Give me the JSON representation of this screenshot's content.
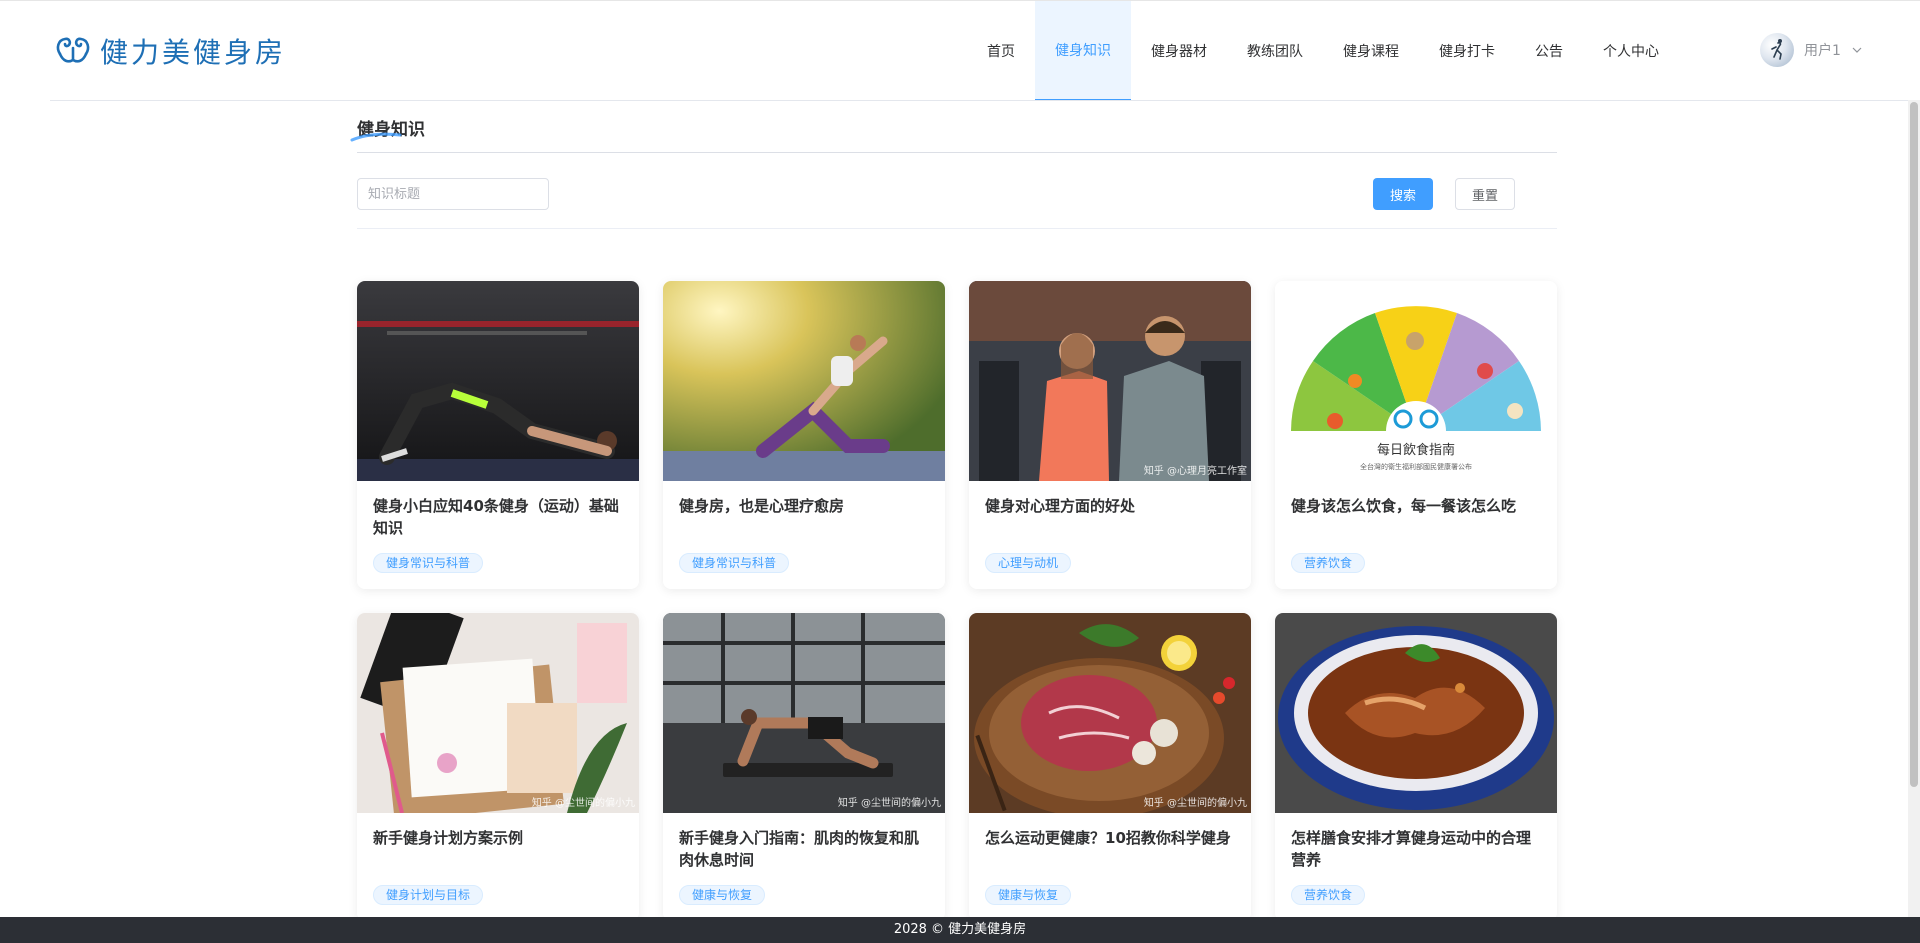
{
  "brand": {
    "name": "健力美健身房",
    "icon": "bicep-icon",
    "color": "#1e6fb5"
  },
  "nav": {
    "items": [
      {
        "label": "首页"
      },
      {
        "label": "健身知识",
        "active": true
      },
      {
        "label": "健身器材"
      },
      {
        "label": "教练团队"
      },
      {
        "label": "健身课程"
      },
      {
        "label": "健身打卡"
      },
      {
        "label": "公告"
      },
      {
        "label": "个人中心"
      }
    ],
    "accent": "#409eff"
  },
  "user": {
    "name": "用户1",
    "icon": "chevron-down-icon"
  },
  "page": {
    "title": "健身知识"
  },
  "search": {
    "placeholder": "知识标题",
    "value": "",
    "search_label": "搜索",
    "reset_label": "重置"
  },
  "cards": [
    {
      "title": "健身小白应知40条健身（运动）基础知识",
      "tag": "健身常识与科普",
      "image": "glute-bridge-photo",
      "watermark": ""
    },
    {
      "title": "健身房，也是心理疗愈房",
      "tag": "健身常识与科普",
      "image": "outdoor-yoga-photo",
      "watermark": ""
    },
    {
      "title": "健身对心理方面的好处",
      "tag": "心理与动机",
      "image": "gym-couple-photo",
      "watermark": "知乎 @心理月亮工作室"
    },
    {
      "title": "健身该怎么饮食，每一餐该怎么吃",
      "tag": "营养饮食",
      "image": "diet-guide-chart",
      "watermark": "",
      "chart_caption": "每日飲食指南",
      "chart_subcaption": "全台灣的衛生福利部國民健康署公布"
    },
    {
      "title": "新手健身计划方案示例",
      "tag": "健身计划与目标",
      "image": "planner-notebook-photo",
      "watermark": "知乎 @尘世间的偏小九"
    },
    {
      "title": "新手健身入门指南：肌肉的恢复和肌肉休息时间",
      "tag": "健康与恢复",
      "image": "pushup-gym-photo",
      "watermark": "知乎 @尘世间的偏小九"
    },
    {
      "title": "怎么运动更健康？10招教你科学健身",
      "tag": "健康与恢复",
      "image": "steak-photo",
      "watermark": "知乎 @尘世间的偏小九"
    },
    {
      "title": "怎样膳食安排才算健身运动中的合理营养",
      "tag": "营养饮食",
      "image": "meat-bowl-photo",
      "watermark": ""
    }
  ],
  "footer": {
    "text": "2028 © 健力美健身房"
  }
}
